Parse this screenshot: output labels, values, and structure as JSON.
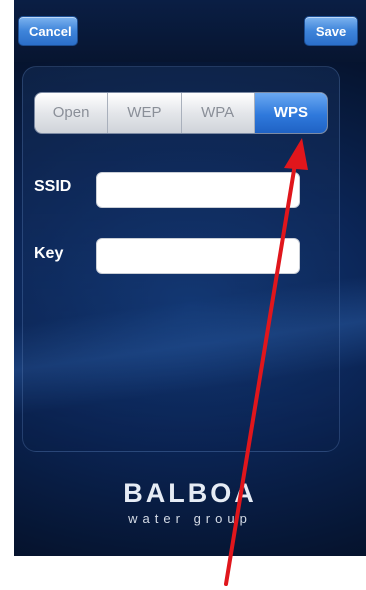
{
  "nav": {
    "cancel_label": "Cancel",
    "save_label": "Save"
  },
  "security_modes": {
    "options": [
      "Open",
      "WEP",
      "WPA",
      "WPS"
    ],
    "selected": "WPS"
  },
  "form": {
    "ssid_label": "SSID",
    "ssid_value": "",
    "key_label": "Key",
    "key_value": ""
  },
  "logo": {
    "brand": "BALBOA",
    "tagline": "water group"
  },
  "colors": {
    "accent": "#2f79dc",
    "annotation_arrow": "#e0161c"
  }
}
